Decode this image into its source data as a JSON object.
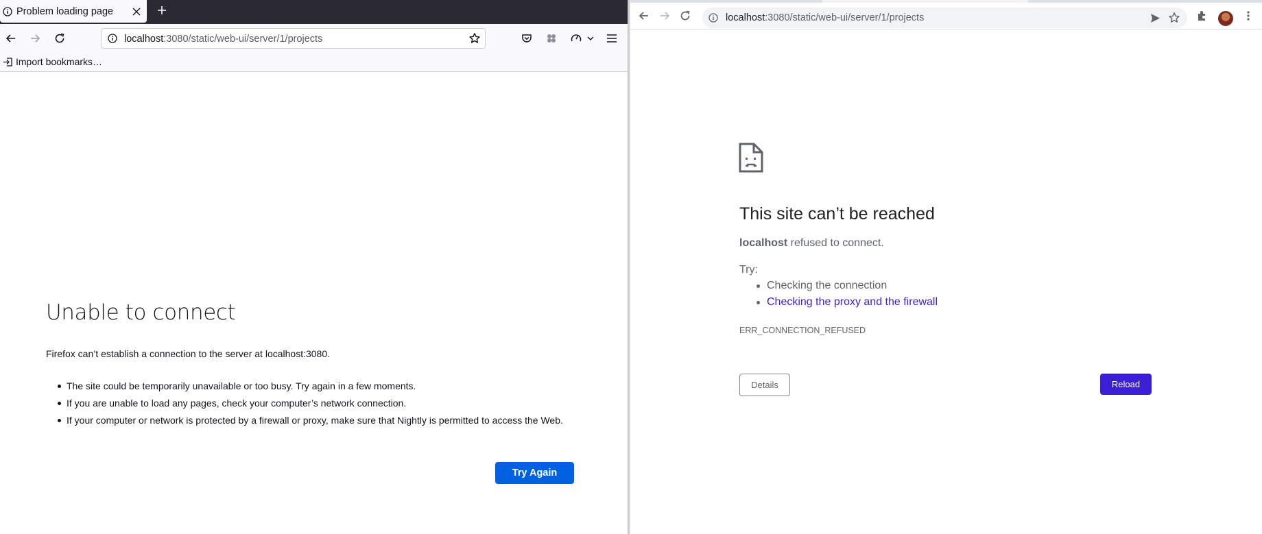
{
  "firefox": {
    "tab": {
      "title": "Problem loading page"
    },
    "url": {
      "host": "localhost",
      "rest": ":3080/static/web-ui/server/1/projects"
    },
    "bookmarks": {
      "import_label": "Import bookmarks…"
    },
    "error": {
      "title": "Unable to connect",
      "description": "Firefox can’t establish a connection to the server at localhost:3080.",
      "bullets": [
        "The site could be temporarily unavailable or too busy. Try again in a few moments.",
        "If you are unable to load any pages, check your computer’s network connection.",
        "If your computer or network is protected by a firewall or proxy, make sure that Nightly is permitted to access the Web."
      ],
      "button_label": "Try Again"
    },
    "colors": {
      "accent": "#0061e0",
      "tabbar": "#2b2a33"
    }
  },
  "chrome": {
    "url": {
      "host": "localhost",
      "rest": ":3080/static/web-ui/server/1/projects"
    },
    "error": {
      "title": "This site can’t be reached",
      "host": "localhost",
      "message_suffix": " refused to connect.",
      "try_label": "Try:",
      "suggestions": [
        "Checking the connection",
        "Checking the proxy and the firewall"
      ],
      "code": "ERR_CONNECTION_REFUSED",
      "details_label": "Details",
      "reload_label": "Reload"
    },
    "colors": {
      "accent": "#3b1fd6",
      "link": "#3b1fd6"
    }
  }
}
